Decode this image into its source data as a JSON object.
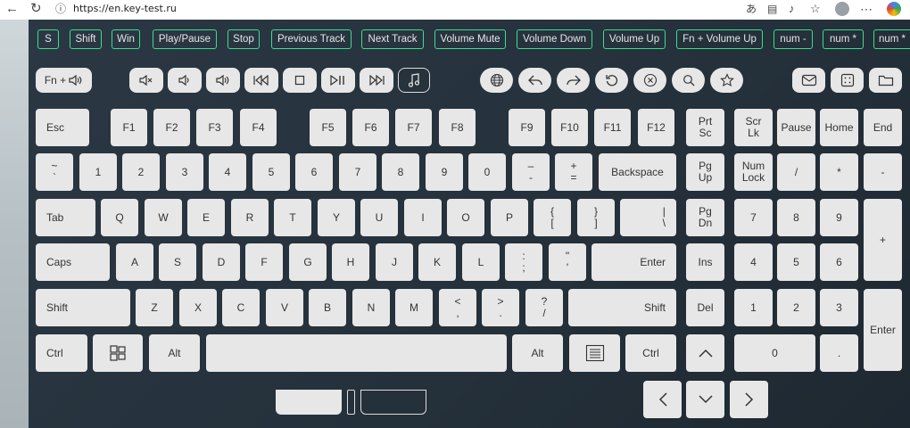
{
  "browser": {
    "url": "https://en.key-test.ru",
    "back_icon": "back-arrow-icon",
    "reload_icon": "reload-icon",
    "info_icon": "site-info-icon"
  },
  "top_row": [
    {
      "label": "S",
      "name": "fn-s"
    },
    {
      "label": "Shift",
      "name": "fn-shift"
    },
    {
      "label": "Win",
      "name": "fn-win"
    },
    {
      "label": "Play/Pause",
      "name": "fn-play-pause"
    },
    {
      "label": "Stop",
      "name": "fn-stop"
    },
    {
      "label": "Previous Track",
      "name": "fn-previous-track"
    },
    {
      "label": "Next Track",
      "name": "fn-next-track"
    },
    {
      "label": "Volume Mute",
      "name": "fn-volume-mute"
    },
    {
      "label": "Volume Down",
      "name": "fn-volume-down"
    },
    {
      "label": "Volume Up",
      "name": "fn-volume-up"
    },
    {
      "label": "Fn + Volume Up",
      "name": "fn-fn-volume-up"
    },
    {
      "label": "num -",
      "name": "fn-num-minus"
    },
    {
      "label": "num *",
      "name": "fn-num-star"
    },
    {
      "label": "num *",
      "name": "fn-num-star-2"
    }
  ],
  "media": {
    "fn_volume_label": "Fn +"
  },
  "keys": {
    "esc": "Esc",
    "f1": "F1",
    "f2": "F2",
    "f3": "F3",
    "f4": "F4",
    "f5": "F5",
    "f6": "F6",
    "f7": "F7",
    "f8": "F8",
    "f9": "F9",
    "f10": "F10",
    "f11": "F11",
    "f12": "F12",
    "prtsc": [
      "Prt",
      "Sc"
    ],
    "scrlk": [
      "Scr",
      "Lk"
    ],
    "pause": "Pause",
    "home": "Home",
    "end": "End",
    "tilde": [
      "~",
      "`"
    ],
    "d1": "1",
    "d2": "2",
    "d3": "3",
    "d4": "4",
    "d5": "5",
    "d6": "6",
    "d7": "7",
    "d8": "8",
    "d9": "9",
    "d0": "0",
    "minus": [
      "–",
      "-"
    ],
    "plus": [
      "+",
      "="
    ],
    "backspace": "Backspace",
    "pgup": [
      "Pg",
      "Up"
    ],
    "numlock": [
      "Num",
      "Lock"
    ],
    "numslash": "/",
    "numstar": "*",
    "numminus": "-",
    "tab": "Tab",
    "q": "Q",
    "w": "W",
    "e": "E",
    "r": "R",
    "t": "T",
    "y": "Y",
    "u": "U",
    "i": "I",
    "o": "O",
    "p": "P",
    "lbracket": [
      "{",
      "["
    ],
    "rbracket": [
      "}",
      "]"
    ],
    "backslash": [
      "|",
      "\\"
    ],
    "pgdn": [
      "Pg",
      "Dn"
    ],
    "n7": "7",
    "n8": "8",
    "n9": "9",
    "numplus": "+",
    "caps": "Caps",
    "a": "A",
    "s": "S",
    "d": "D",
    "f": "F",
    "g": "G",
    "h": "H",
    "j": "J",
    "k": "K",
    "l": "L",
    "semicolon": [
      ":",
      ";"
    ],
    "quote": [
      "\"",
      "'"
    ],
    "enter": "Enter",
    "ins": "Ins",
    "n4": "4",
    "n5": "5",
    "n6": "6",
    "lshift": "Shift",
    "z": "Z",
    "x": "X",
    "c": "C",
    "v": "V",
    "b": "B",
    "n": "N",
    "m": "M",
    "comma": [
      "<",
      ","
    ],
    "period": [
      ">",
      "."
    ],
    "slash": [
      "?",
      "/"
    ],
    "rshift": "Shift",
    "del": "Del",
    "n1": "1",
    "n2": "2",
    "n3": "3",
    "numenter": "Enter",
    "lctrl": "Ctrl",
    "lalt": "Alt",
    "ralt": "Alt",
    "rctrl": "Ctrl",
    "n0": "0",
    "numdot": "."
  },
  "colors": {
    "panel": "#26323c",
    "key": "#e7e7e7",
    "accent": "#3ddc91"
  }
}
